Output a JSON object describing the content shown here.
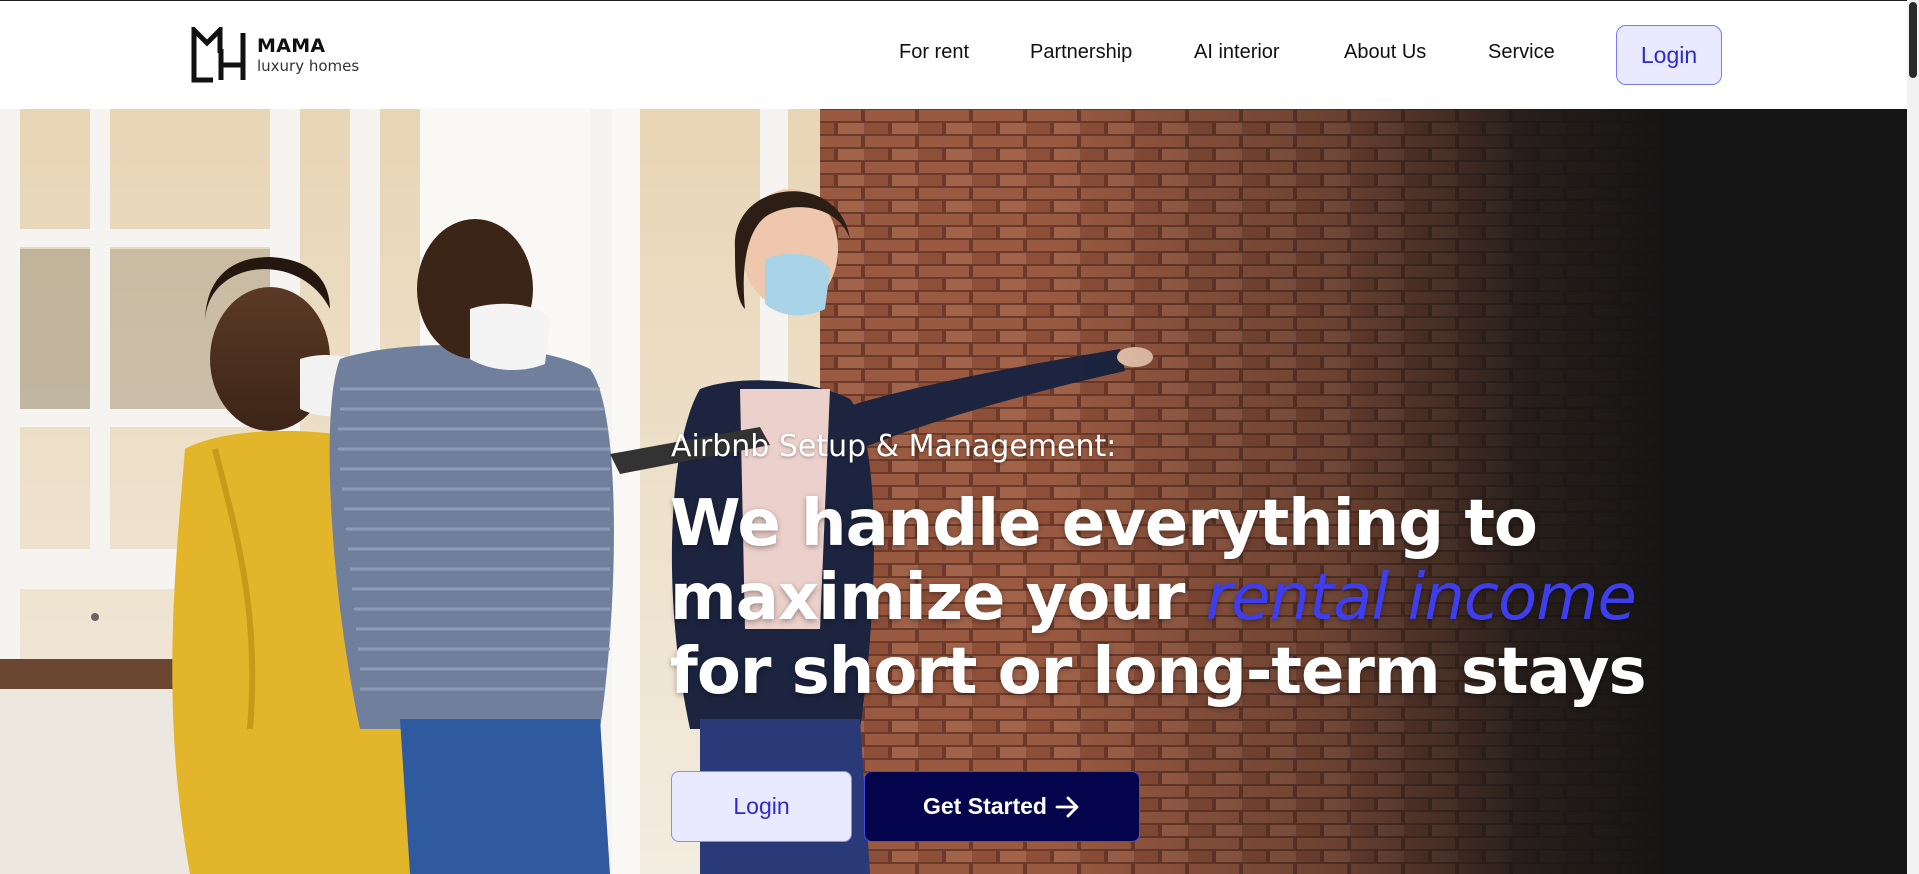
{
  "brand": {
    "title": "MAMA",
    "subtitle": "luxury homes",
    "logo_letters": "LH"
  },
  "nav": {
    "items": [
      {
        "label": "For rent"
      },
      {
        "label": "Partnership"
      },
      {
        "label": "AI interior"
      },
      {
        "label": "About Us"
      },
      {
        "label": "Service"
      }
    ],
    "login_label": "Login"
  },
  "hero": {
    "eyebrow": "Airbnb Setup & Management:",
    "headline_part1": "We handle everything to maximize your ",
    "headline_accent": "rental income",
    "headline_part2": " for short or long-term stays",
    "login_label": "Login",
    "get_started_label": "Get Started",
    "arrow_icon": "arrow-right-icon"
  },
  "colors": {
    "accent": "#3e3ef0",
    "login_bg": "#e9e9ff",
    "login_text": "#2b2bd1",
    "cta_bg": "#05054d",
    "hero_dark": "#141414"
  }
}
